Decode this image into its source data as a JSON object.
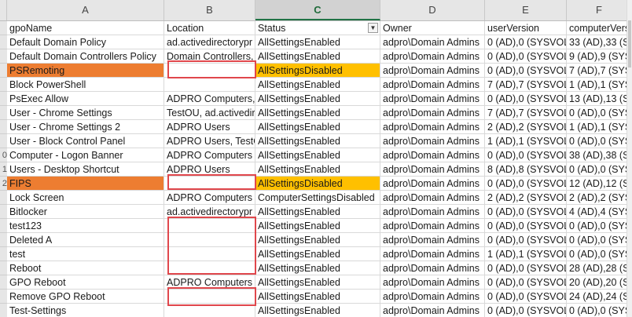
{
  "colors": {
    "orange_highlight": "#ed7d31",
    "yellow_highlight": "#ffc000",
    "red_box": "#e0474c",
    "header_bg": "#e6e6e6",
    "selected_header_text": "#1f6b3a"
  },
  "columns": [
    {
      "letter": "A",
      "selected": false
    },
    {
      "letter": "B",
      "selected": false
    },
    {
      "letter": "C",
      "selected": true
    },
    {
      "letter": "D",
      "selected": false
    },
    {
      "letter": "E",
      "selected": false
    },
    {
      "letter": "F",
      "selected": false
    }
  ],
  "filter_icon": "filter-dropdown-icon",
  "rows": [
    {
      "num": "",
      "cells": [
        "gpoName",
        "Location",
        "Status",
        "Owner",
        "userVersion",
        "computerVers"
      ],
      "highlight": "none",
      "header": true
    },
    {
      "num": "",
      "cells": [
        "Default Domain Policy",
        "ad.activedirectorypr",
        "AllSettingsEnabled",
        "adpro\\Domain Admins",
        "0 (AD),0 (SYSVOL)",
        "33 (AD),33 (SYS"
      ],
      "highlight": "none"
    },
    {
      "num": "",
      "cells": [
        "Default Domain Controllers Policy",
        "Domain Controllers,",
        "AllSettingsEnabled",
        "adpro\\Domain Admins",
        "0 (AD),0 (SYSVOL)",
        "9 (AD),9 (SYSV"
      ],
      "highlight": "none"
    },
    {
      "num": "",
      "cells": [
        "PSRemoting",
        "",
        "AllSettingsDisabled",
        "adpro\\Domain Admins",
        "0 (AD),0 (SYSVOL)",
        "7 (AD),7 (SYSV"
      ],
      "highlight": "row"
    },
    {
      "num": "",
      "cells": [
        "Block PowerShell",
        "",
        "AllSettingsEnabled",
        "adpro\\Domain Admins",
        "7 (AD),7 (SYSVOL)",
        "1 (AD),1 (SYSV"
      ],
      "highlight": "none"
    },
    {
      "num": "",
      "cells": [
        "PsExec Allow",
        "ADPRO Computers, T",
        "AllSettingsEnabled",
        "adpro\\Domain Admins",
        "0 (AD),0 (SYSVOL)",
        "13 (AD),13 (SYS"
      ],
      "highlight": "none"
    },
    {
      "num": "",
      "cells": [
        "User - Chrome Settings",
        "TestOU, ad.activedir",
        "AllSettingsEnabled",
        "adpro\\Domain Admins",
        "7 (AD),7 (SYSVOL)",
        "0 (AD),0 (SYSV"
      ],
      "highlight": "none"
    },
    {
      "num": "",
      "cells": [
        "User - Chrome Settings 2",
        "ADPRO Users",
        "AllSettingsEnabled",
        "adpro\\Domain Admins",
        "2 (AD),2 (SYSVOL)",
        "1 (AD),1 (SYSV"
      ],
      "highlight": "none"
    },
    {
      "num": "",
      "cells": [
        "User - Block Control Panel",
        "ADPRO Users, TestOU",
        "AllSettingsEnabled",
        "adpro\\Domain Admins",
        "1 (AD),1 (SYSVOL)",
        "0 (AD),0 (SYSV"
      ],
      "highlight": "none"
    },
    {
      "num": "0",
      "cells": [
        "Computer - Logon Banner",
        "ADPRO Computers",
        "AllSettingsEnabled",
        "adpro\\Domain Admins",
        "0 (AD),0 (SYSVOL)",
        "38 (AD),38 (SYS"
      ],
      "highlight": "none"
    },
    {
      "num": "1",
      "cells": [
        "Users - Desktop Shortcut",
        "ADPRO Users",
        "AllSettingsEnabled",
        "adpro\\Domain Admins",
        "8 (AD),8 (SYSVOL)",
        "0 (AD),0 (SYSV"
      ],
      "highlight": "none"
    },
    {
      "num": "2",
      "cells": [
        "FIPS",
        "",
        "AllSettingsDisabled",
        "adpro\\Domain Admins",
        "0 (AD),0 (SYSVOL)",
        "12 (AD),12 (SYS"
      ],
      "highlight": "row"
    },
    {
      "num": "",
      "cells": [
        "Lock Screen",
        "ADPRO Computers",
        "ComputerSettingsDisabled",
        "adpro\\Domain Admins",
        "2 (AD),2 (SYSVOL)",
        "2 (AD),2 (SYSV"
      ],
      "highlight": "none"
    },
    {
      "num": "",
      "cells": [
        "Bitlocker",
        "ad.activedirectorypr",
        "AllSettingsEnabled",
        "adpro\\Domain Admins",
        "0 (AD),0 (SYSVOL)",
        "4 (AD),4 (SYSV"
      ],
      "highlight": "none"
    },
    {
      "num": "",
      "cells": [
        "test123",
        "",
        "AllSettingsEnabled",
        "adpro\\Domain Admins",
        "0 (AD),0 (SYSVOL)",
        "0 (AD),0 (SYSV"
      ],
      "highlight": "none"
    },
    {
      "num": "",
      "cells": [
        "Deleted A",
        "",
        "AllSettingsEnabled",
        "adpro\\Domain Admins",
        "0 (AD),0 (SYSVOL)",
        "0 (AD),0 (SYSV"
      ],
      "highlight": "none"
    },
    {
      "num": "",
      "cells": [
        "test",
        "",
        "AllSettingsEnabled",
        "adpro\\Domain Admins",
        "1 (AD),1 (SYSVOL)",
        "0 (AD),0 (SYSV"
      ],
      "highlight": "none"
    },
    {
      "num": "",
      "cells": [
        "Reboot",
        "",
        "AllSettingsEnabled",
        "adpro\\Domain Admins",
        "0 (AD),0 (SYSVOL)",
        "28 (AD),28 (SYS"
      ],
      "highlight": "none"
    },
    {
      "num": "",
      "cells": [
        "GPO Reboot",
        "ADPRO Computers",
        "AllSettingsEnabled",
        "adpro\\Domain Admins",
        "0 (AD),0 (SYSVOL)",
        "20 (AD),20 (SYS"
      ],
      "highlight": "none"
    },
    {
      "num": "",
      "cells": [
        "Remove GPO Reboot",
        "",
        "AllSettingsEnabled",
        "adpro\\Domain Admins",
        "0 (AD),0 (SYSVOL)",
        "24 (AD),24 (SYS"
      ],
      "highlight": "none"
    },
    {
      "num": "",
      "cells": [
        "Test-Settings",
        "",
        "AllSettingsEnabled",
        "adpro\\Domain Admins",
        "0 (AD),0 (SYSVOL)",
        "0 (AD),0 (SYSV"
      ],
      "highlight": "none"
    }
  ]
}
